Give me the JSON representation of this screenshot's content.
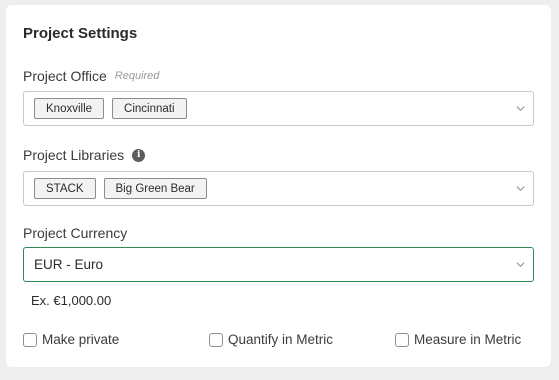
{
  "panel": {
    "title": "Project Settings"
  },
  "project_office": {
    "label": "Project Office",
    "hint": "Required",
    "chips": [
      "Knoxville",
      "Cincinnati"
    ]
  },
  "project_libraries": {
    "label": "Project Libraries",
    "info_icon": "i",
    "chips": [
      "STACK",
      "Big Green Bear"
    ]
  },
  "project_currency": {
    "label": "Project Currency",
    "value": "EUR - Euro",
    "example": "Ex. €1,000.00"
  },
  "options": {
    "make_private": "Make private",
    "quantify_metric": "Quantify in Metric",
    "measure_metric": "Measure in Metric"
  },
  "colors": {
    "focus_border": "#2e8b57"
  }
}
